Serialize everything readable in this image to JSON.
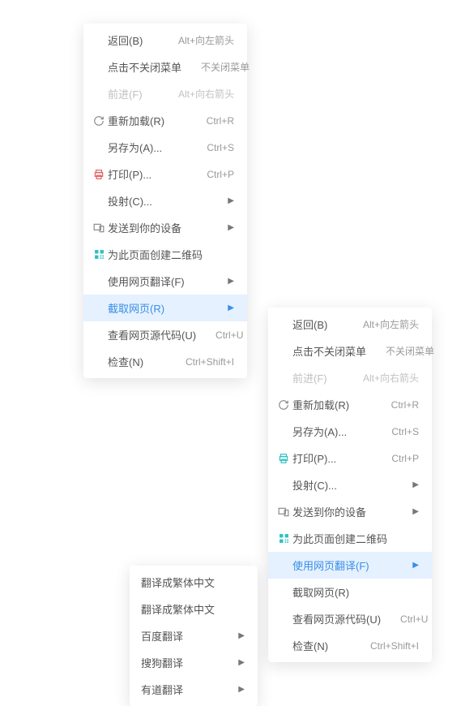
{
  "menu1": {
    "items": [
      {
        "label": "返回(B)",
        "shortcut": "Alt+向左箭头",
        "icon": "",
        "disabled": false,
        "hasArrow": false
      },
      {
        "label": "点击不关闭菜单",
        "shortcut": "不关闭菜单",
        "icon": "",
        "disabled": false,
        "hasArrow": false
      },
      {
        "label": "前进(F)",
        "shortcut": "Alt+向右箭头",
        "icon": "",
        "disabled": true,
        "hasArrow": false
      },
      {
        "label": "重新加载(R)",
        "shortcut": "Ctrl+R",
        "icon": "reload",
        "disabled": false,
        "hasArrow": false
      },
      {
        "label": "另存为(A)...",
        "shortcut": "Ctrl+S",
        "icon": "",
        "disabled": false,
        "hasArrow": false
      },
      {
        "label": "打印(P)...",
        "shortcut": "Ctrl+P",
        "icon": "print-red",
        "disabled": false,
        "hasArrow": false
      },
      {
        "label": "投射(C)...",
        "shortcut": "",
        "icon": "",
        "disabled": false,
        "hasArrow": true
      },
      {
        "label": "发送到你的设备",
        "shortcut": "",
        "icon": "devices",
        "disabled": false,
        "hasArrow": true
      },
      {
        "label": "为此页面创建二维码",
        "shortcut": "",
        "icon": "qr",
        "disabled": false,
        "hasArrow": false
      },
      {
        "label": "使用网页翻译(F)",
        "shortcut": "",
        "icon": "",
        "disabled": false,
        "hasArrow": true
      },
      {
        "label": "截取网页(R)",
        "shortcut": "",
        "icon": "",
        "disabled": false,
        "hasArrow": true,
        "highlighted": true
      },
      {
        "label": "查看网页源代码(U)",
        "shortcut": "Ctrl+U",
        "icon": "",
        "disabled": false,
        "hasArrow": false
      },
      {
        "label": "检查(N)",
        "shortcut": "Ctrl+Shift+I",
        "icon": "",
        "disabled": false,
        "hasArrow": false
      }
    ]
  },
  "menu2": {
    "items": [
      {
        "label": "返回(B)",
        "shortcut": "Alt+向左箭头",
        "icon": "",
        "disabled": false,
        "hasArrow": false
      },
      {
        "label": "点击不关闭菜单",
        "shortcut": "不关闭菜单",
        "icon": "",
        "disabled": false,
        "hasArrow": false
      },
      {
        "label": "前进(F)",
        "shortcut": "Alt+向右箭头",
        "icon": "",
        "disabled": true,
        "hasArrow": false
      },
      {
        "label": "重新加载(R)",
        "shortcut": "Ctrl+R",
        "icon": "reload",
        "disabled": false,
        "hasArrow": false
      },
      {
        "label": "另存为(A)...",
        "shortcut": "Ctrl+S",
        "icon": "",
        "disabled": false,
        "hasArrow": false
      },
      {
        "label": "打印(P)...",
        "shortcut": "Ctrl+P",
        "icon": "print-teal",
        "disabled": false,
        "hasArrow": false
      },
      {
        "label": "投射(C)...",
        "shortcut": "",
        "icon": "",
        "disabled": false,
        "hasArrow": true
      },
      {
        "label": "发送到你的设备",
        "shortcut": "",
        "icon": "devices",
        "disabled": false,
        "hasArrow": true
      },
      {
        "label": "为此页面创建二维码",
        "shortcut": "",
        "icon": "qr",
        "disabled": false,
        "hasArrow": false
      },
      {
        "label": "使用网页翻译(F)",
        "shortcut": "",
        "icon": "",
        "disabled": false,
        "hasArrow": true,
        "highlighted": true
      },
      {
        "label": "截取网页(R)",
        "shortcut": "",
        "icon": "",
        "disabled": false,
        "hasArrow": false
      },
      {
        "label": "查看网页源代码(U)",
        "shortcut": "Ctrl+U",
        "icon": "",
        "disabled": false,
        "hasArrow": false
      },
      {
        "label": "检查(N)",
        "shortcut": "Ctrl+Shift+I",
        "icon": "",
        "disabled": false,
        "hasArrow": false
      }
    ]
  },
  "submenu1": {
    "items": [
      {
        "label": "翻译成繁体中文",
        "hasArrow": false
      },
      {
        "label": "翻译成繁体中文",
        "hasArrow": false
      },
      {
        "label": "百度翻译",
        "hasArrow": true
      },
      {
        "label": "搜狗翻译",
        "hasArrow": true
      },
      {
        "label": "有道翻译",
        "hasArrow": true
      }
    ]
  }
}
